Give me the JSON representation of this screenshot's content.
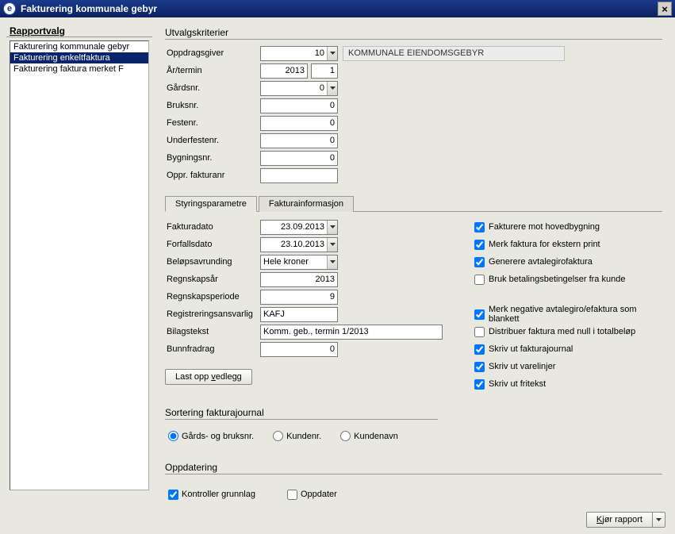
{
  "window": {
    "title": "Fakturering kommunale gebyr"
  },
  "sidebar": {
    "title": "Rapportvalg",
    "items": [
      {
        "label": "Fakturering kommunale gebyr",
        "selected": false
      },
      {
        "label": "Fakturering enkeltfaktura",
        "selected": true
      },
      {
        "label": "Fakturering faktura merket F",
        "selected": false
      }
    ]
  },
  "criteria": {
    "title": "Utvalgskriterier",
    "oppdragsgiver_label": "Oppdragsgiver",
    "oppdragsgiver_value": "10",
    "oppdragsgiver_text": "KOMMUNALE EIENDOMSGEBYR",
    "aar_termin_label": "År/termin",
    "aar_value": "2013",
    "termin_value": "1",
    "gardsnr_label": "Gårdsnr.",
    "gardsnr_value": "0",
    "bruksnr_label": "Bruksnr.",
    "bruksnr_value": "0",
    "festenr_label": "Festenr.",
    "festenr_value": "0",
    "underfestenr_label": "Underfestenr.",
    "underfestenr_value": "0",
    "bygningsnr_label": "Bygningsnr.",
    "bygningsnr_value": "0",
    "oppr_fakturanr_label": "Oppr. fakturanr",
    "oppr_fakturanr_value": ""
  },
  "tabs": {
    "tab1": "Styringsparametre",
    "tab2": "Fakturainformasjon"
  },
  "params": {
    "fakturadato_label": "Fakturadato",
    "fakturadato_value": "23.09.2013",
    "forfallsdato_label": "Forfallsdato",
    "forfallsdato_value": "23.10.2013",
    "belopsavrunding_label": "Beløpsavrunding",
    "belopsavrunding_value": "Hele kroner",
    "regnskapsaar_label": "Regnskapsår",
    "regnskapsaar_value": "2013",
    "regnskapsperiode_label": "Regnskapsperiode",
    "regnskapsperiode_value": "9",
    "registreringsansvarlig_label": "Registreringsansvarlig",
    "registreringsansvarlig_value": "KAFJ",
    "bilagstekst_label": "Bilagstekst",
    "bilagstekst_value": "Komm. geb., termin 1/2013",
    "bunnfradrag_label": "Bunnfradrag",
    "bunnfradrag_value": "0",
    "upload_button_pre": "Last opp ",
    "upload_button_hot": "v",
    "upload_button_post": "edlegg"
  },
  "checks": {
    "c1": "Fakturere mot hovedbygning",
    "c2_pre": "",
    "c2_hot": "M",
    "c2_post": "erk faktura for ekstern print",
    "c3_pre": "",
    "c3_hot": "G",
    "c3_post": "enerere avtalegirofaktura",
    "c4": "Bruk betalingsbetingelser fra kunde",
    "c5": "Merk negative avtalegiro/efaktura som blankett",
    "c6": "Distribuer faktura med null i totalbeløp",
    "c7": "Skriv ut fakturajournal",
    "c8": "Skriv ut varelinjer",
    "c9": "Skriv ut fritekst"
  },
  "sorting": {
    "title": "Sortering fakturajournal",
    "r1": "Gårds- og bruksnr.",
    "r2_pre": "Kunden",
    "r2_hot": "r",
    "r2_post": ".",
    "r3_pre": "K",
    "r3_hot": "u",
    "r3_post": "ndenavn"
  },
  "update": {
    "title": "Oppdatering",
    "c1": "Kontroller grunnlag",
    "c2_pre": "",
    "c2_hot": "O",
    "c2_post": "ppdater"
  },
  "footer": {
    "run_pre": "",
    "run_hot": "K",
    "run_post": "jør rapport"
  }
}
